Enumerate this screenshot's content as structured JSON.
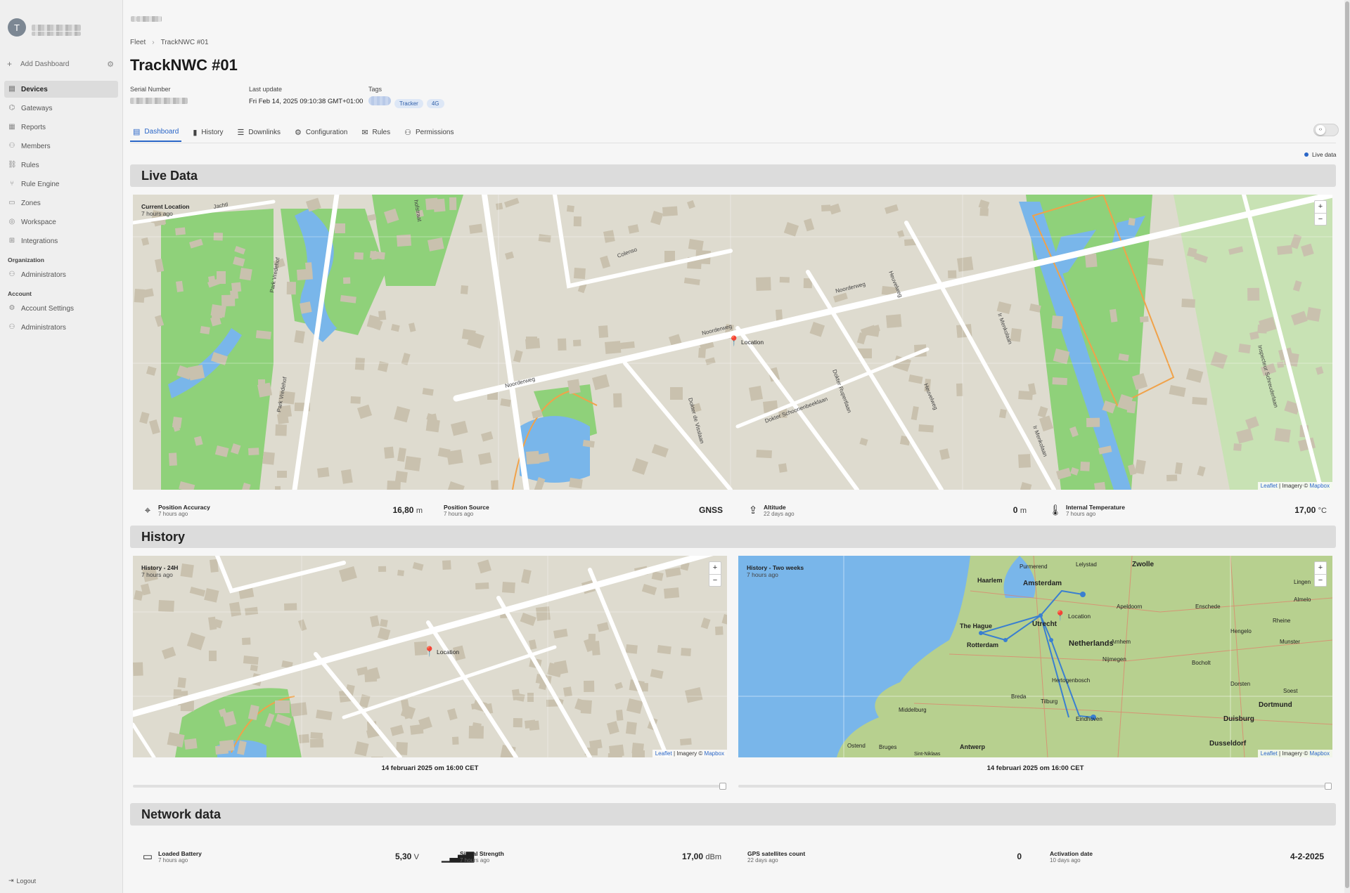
{
  "sidebar": {
    "avatar_letter": "T",
    "add_dashboard": "Add Dashboard",
    "items": [
      {
        "label": "Devices",
        "icon": "devices-icon"
      },
      {
        "label": "Gateways",
        "icon": "gateway-icon"
      },
      {
        "label": "Reports",
        "icon": "reports-icon"
      },
      {
        "label": "Members",
        "icon": "members-icon"
      },
      {
        "label": "Rules",
        "icon": "rules-icon"
      },
      {
        "label": "Rule Engine",
        "icon": "rule-engine-icon"
      },
      {
        "label": "Zones",
        "icon": "zones-icon"
      },
      {
        "label": "Workspace",
        "icon": "workspace-icon"
      },
      {
        "label": "Integrations",
        "icon": "integrations-icon"
      }
    ],
    "organization_heading": "Organization",
    "organization_items": [
      {
        "label": "Administrators"
      }
    ],
    "account_heading": "Account",
    "account_items": [
      {
        "label": "Account Settings"
      },
      {
        "label": "Administrators"
      }
    ],
    "logout": "Logout"
  },
  "breadcrumb": {
    "root": "Fleet",
    "current": "TrackNWC #01"
  },
  "device": {
    "title": "TrackNWC #01",
    "serial_label": "Serial Number",
    "last_update_label": "Last update",
    "last_update": "Fri Feb 14, 2025 09:10:38 GMT+01:00",
    "tags_label": "Tags",
    "tags": [
      "Tracker",
      "4G"
    ]
  },
  "tabs": [
    "Dashboard",
    "History",
    "Downlinks",
    "Configuration",
    "Rules",
    "Permissions"
  ],
  "live_indicator": "Live data",
  "sections": {
    "live": "Live Data",
    "history": "History",
    "network": "Network data"
  },
  "live_map": {
    "label": "Current Location",
    "ago": "7 hours ago",
    "pin_label": "Location",
    "streets": [
      "Noorderweg",
      "Noorderweg",
      "Noorderweg",
      "Colenso",
      "Park Vredehof",
      "Park Vredehof",
      "Dokter de Visslaan",
      "Dokter Schoonenbeeklaan",
      "Dokter Rupertlaan",
      "Heuvelweg",
      "Heuvelweg",
      "Ir Menkolaan",
      "Ir Menkolaan",
      "Inspecteur Schreuderlaan",
      "Jachtl",
      "hofstraat"
    ]
  },
  "map_attribution": {
    "leaflet": "Leaflet",
    "sep": "| Imagery ©",
    "mapbox": "Mapbox"
  },
  "live_stats": [
    {
      "name": "Position Accuracy",
      "ago": "7 hours ago",
      "value": "16,80",
      "unit": "m",
      "icon": "crosshair-icon"
    },
    {
      "name": "Position Source",
      "ago": "7 hours ago",
      "value": "GNSS",
      "unit": "",
      "icon": ""
    },
    {
      "name": "Altitude",
      "ago": "22 days ago",
      "value": "0",
      "unit": "m",
      "icon": "altitude-icon"
    },
    {
      "name": "Internal Temperature",
      "ago": "7 hours ago",
      "value": "17,00",
      "unit": "°C",
      "icon": "thermometer-icon"
    }
  ],
  "history_24h": {
    "label": "History - 24H",
    "ago": "7 hours ago",
    "pin_label": "Location",
    "caption": "14 februari 2025 om 16:00 CET",
    "slider_position": 1.0
  },
  "history_2w": {
    "label": "History - Two weeks",
    "ago": "7 hours ago",
    "pin_label": "Location",
    "caption": "14 februari 2025 om 16:00 CET",
    "slider_position": 1.0,
    "places": [
      "Zwolle",
      "Lelystad",
      "Purmerend",
      "Haarlem",
      "Amsterdam",
      "Apeldoorn",
      "Enschede",
      "The Hague",
      "Utrecht",
      "Netherlands",
      "Rotterdam",
      "Nijmegen",
      "Hertogenbosch",
      "Breda",
      "Tilburg",
      "Middelburg",
      "Eindhoven",
      "Antwerp",
      "Duisburg",
      "Dortmund",
      "Dusseldorf",
      "Munster",
      "Bocholt",
      "Hengelo",
      "Rheine",
      "Lingen",
      "Soest",
      "Arnhem",
      "Ostend",
      "Bruges",
      "Sint-Niklaas",
      "Almelo",
      "Dorsten"
    ]
  },
  "network_stats": [
    {
      "name": "Loaded Battery",
      "ago": "7 hours ago",
      "value": "5,30",
      "unit": "V",
      "icon": "battery-icon"
    },
    {
      "name": "Signal Strength",
      "ago": "7 hours ago",
      "value": "17,00",
      "unit": "dBm",
      "icon": "signal-icon"
    },
    {
      "name": "GPS satellites count",
      "ago": "22 days ago",
      "value": "0",
      "unit": "",
      "icon": ""
    },
    {
      "name": "Activation date",
      "ago": "10 days ago",
      "value": "4-2-2025",
      "unit": "",
      "icon": ""
    }
  ],
  "colors": {
    "accent": "#2a66c7",
    "map_land": "#dedbcf",
    "map_green": "#8fd17a",
    "map_water": "#79b6ea",
    "building": "#c9c1ae"
  }
}
